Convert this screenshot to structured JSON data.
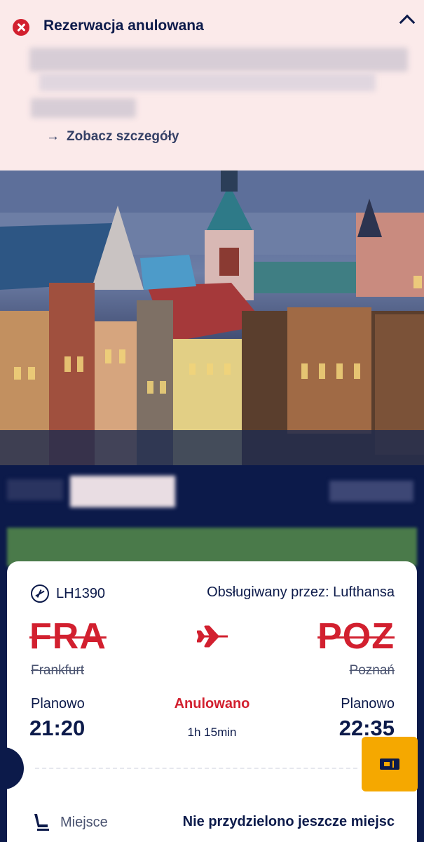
{
  "banner": {
    "title": "Rezerwacja anulowana",
    "details_link": "Zobacz szczegóły",
    "colors": {
      "background": "#fbeaea",
      "error": "#d2202f"
    }
  },
  "hero": {
    "icon": "city-photo"
  },
  "flight": {
    "number": "LH1390",
    "operated_by": "Obsługiwany przez: Lufthansa",
    "from": {
      "code": "FRA",
      "city": "Frankfurt",
      "label": "Planowo",
      "time": "21:20"
    },
    "to": {
      "code": "POZ",
      "city": "Poznań",
      "label": "Planowo",
      "time": "22:35"
    },
    "status": "Anulowano",
    "duration": "1h 15min"
  },
  "seat": {
    "label": "Miejsce",
    "value": "Nie przydzielono jeszcze miejsc"
  },
  "colors": {
    "navy": "#0c1a4a",
    "accent": "#f5a800",
    "cancel_red": "#d2202f"
  }
}
